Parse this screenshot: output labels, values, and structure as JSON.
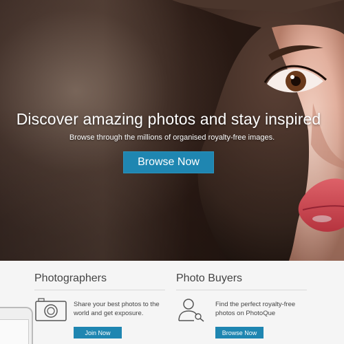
{
  "hero": {
    "title": "Discover amazing photos and stay inspired",
    "subtitle": "Browse through the millions of organised royalty-free images.",
    "cta_label": "Browse Now"
  },
  "photographers": {
    "title": "Photographers",
    "icon": "camera-icon",
    "text": "Share your best photos to the world and get exposure.",
    "button_label": "Join Now"
  },
  "buyers": {
    "title": "Photo Buyers",
    "icon": "user-search-icon",
    "text": "Find the perfect royalty-free photos on PhotoQue",
    "button_label": "Browse Now"
  },
  "colors": {
    "accent": "#1f86b1",
    "lips": "#e8525c",
    "hat_fur": "#3a2820"
  }
}
